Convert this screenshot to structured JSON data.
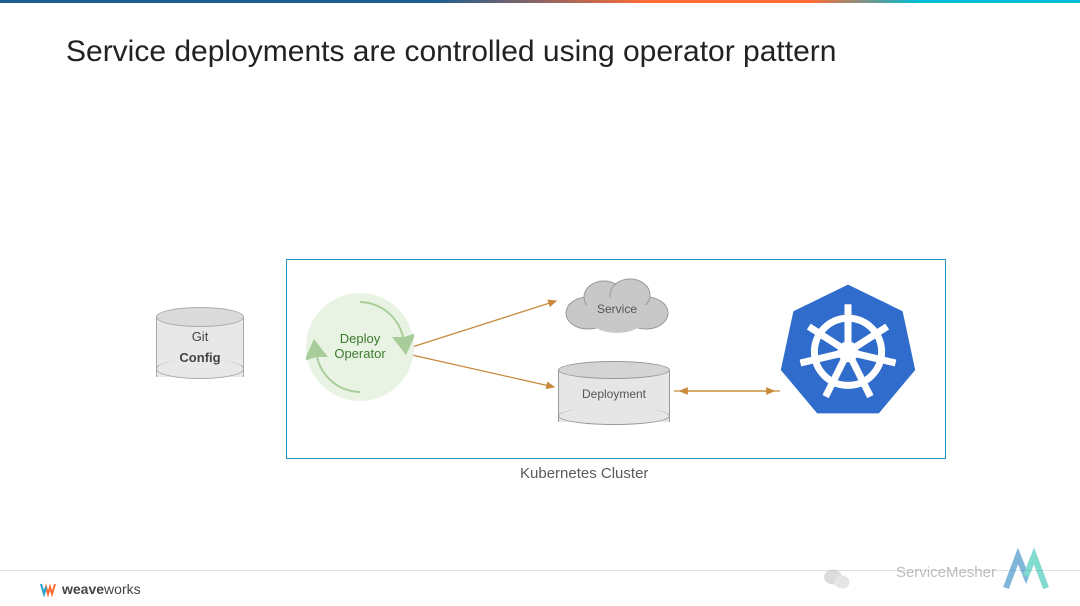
{
  "title": "Service deployments are controlled using operator pattern",
  "git": {
    "line1": "Git",
    "line2": "Config"
  },
  "operator": {
    "line1": "Deploy",
    "line2": "Operator"
  },
  "service_label": "Service",
  "deployment_label": "Deployment",
  "cluster_label": "Kubernetes Cluster",
  "brand": {
    "left": "weave",
    "right": "works"
  },
  "watermark": "ServiceMesher"
}
